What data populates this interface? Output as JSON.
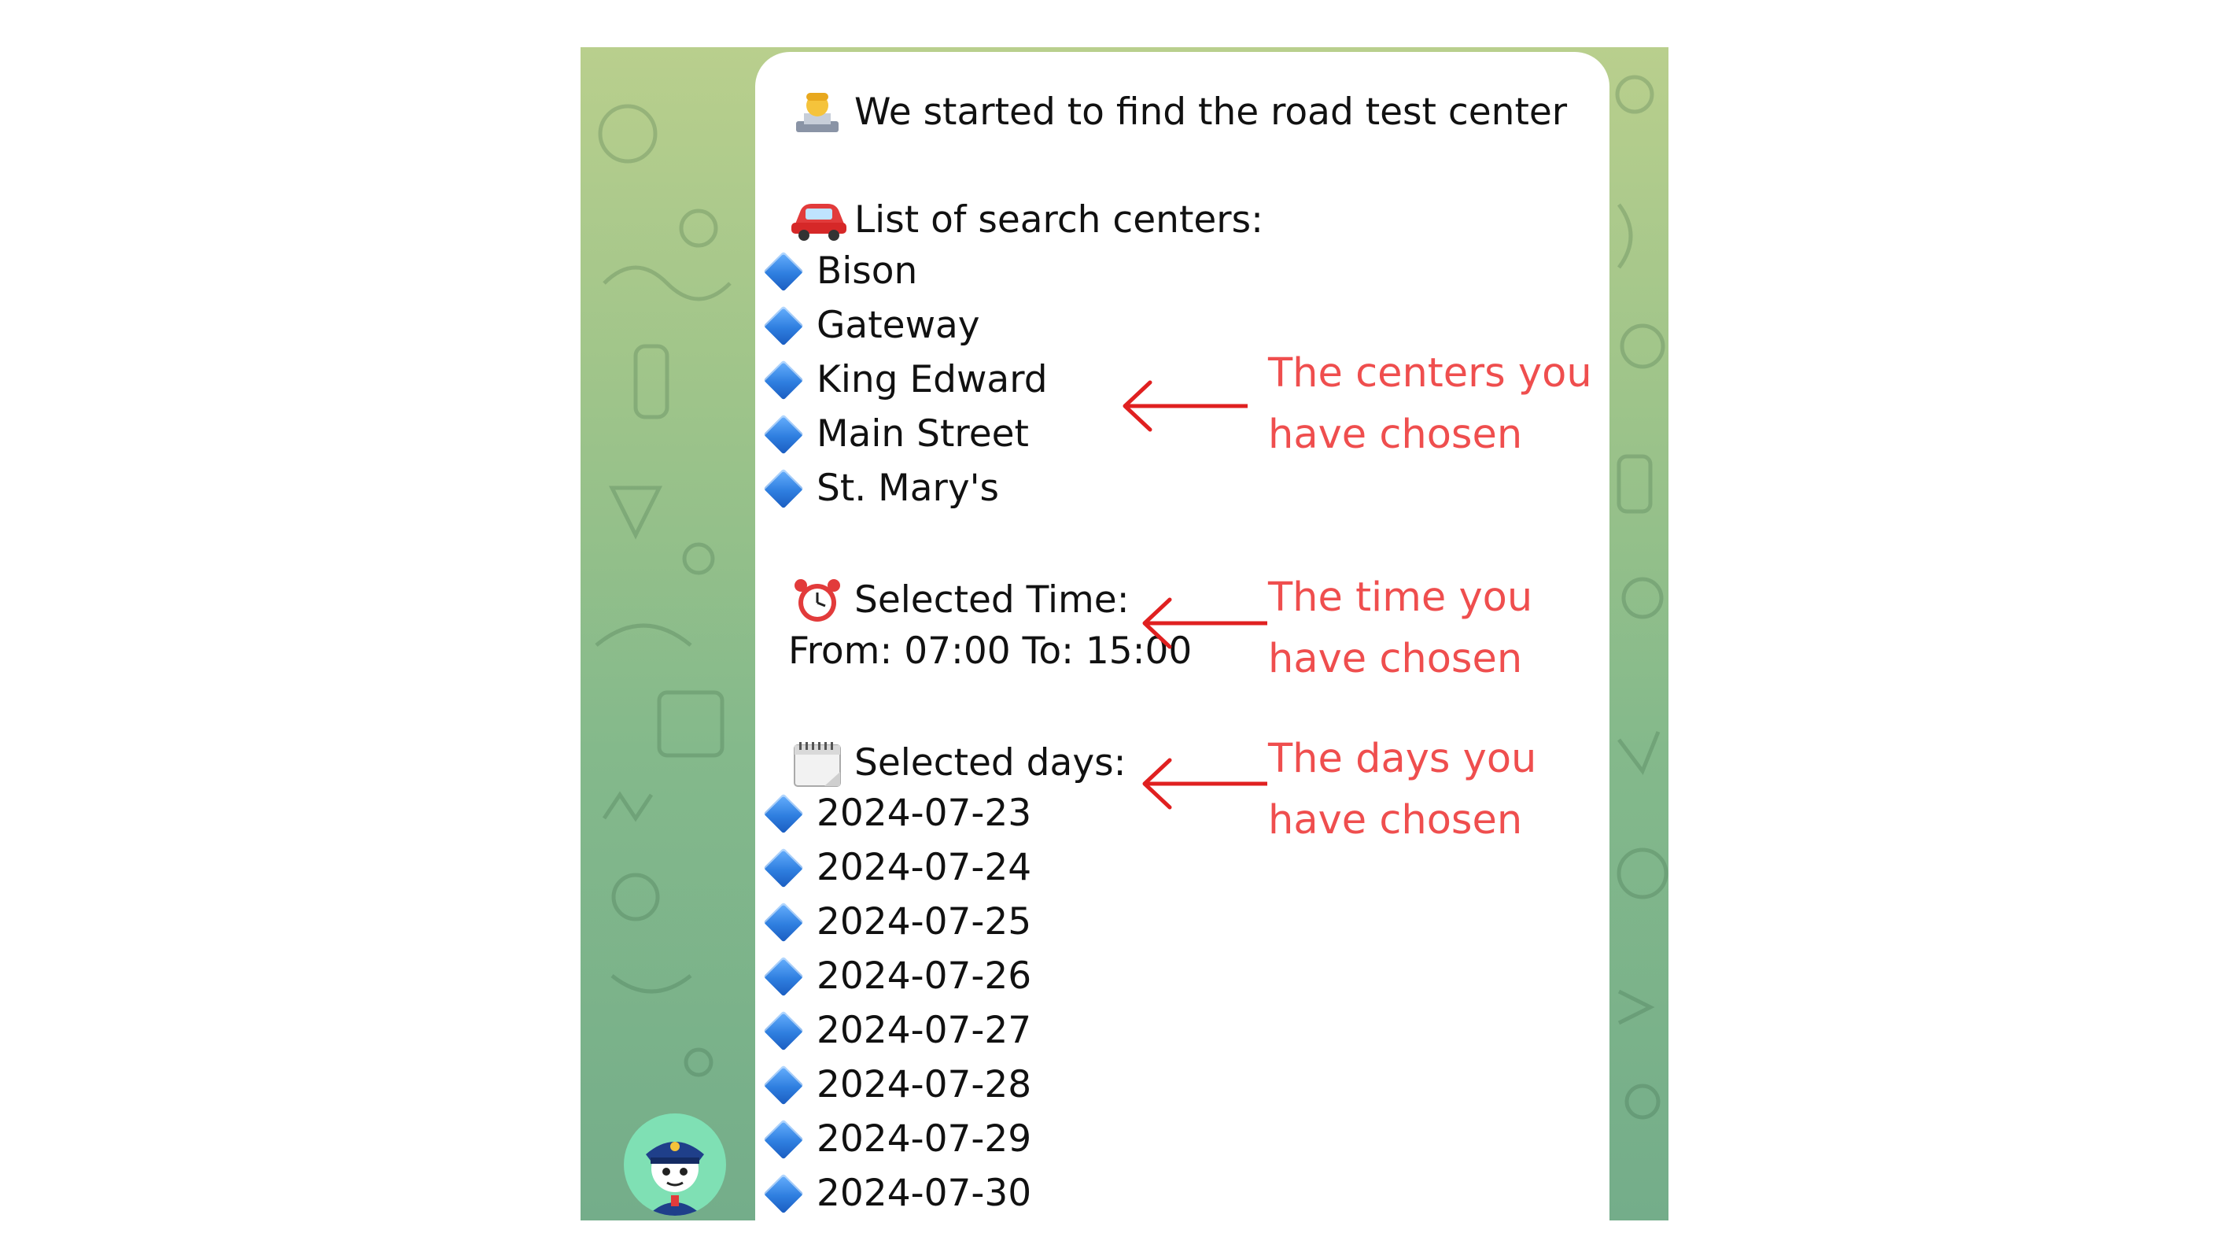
{
  "message": {
    "header": "We started to find the road test center",
    "centers_heading": "List of search centers:",
    "centers": [
      "Bison",
      "Gateway",
      "King Edward",
      "Main Street",
      "St. Mary's"
    ],
    "time_heading": "Selected Time:",
    "time_range": "From: 07:00 To: 15:00",
    "days_heading": "Selected days:",
    "days": [
      "2024-07-23",
      "2024-07-24",
      "2024-07-25",
      "2024-07-26",
      "2024-07-27",
      "2024-07-28",
      "2024-07-29",
      "2024-07-30"
    ]
  },
  "annotations": {
    "centers": [
      "The centers you",
      "have chosen"
    ],
    "time": [
      "The time you",
      "have chosen"
    ],
    "days": [
      "The days you",
      "have chosen"
    ]
  },
  "icons": {
    "header": "technologist-emoji",
    "centers": "red-car-emoji",
    "time": "alarm-clock-emoji",
    "days": "calendar-emoji",
    "bullet": "blue-diamond-emoji",
    "avatar": "police-officer-bot-avatar"
  },
  "colors": {
    "annotation": "#ef4e4e",
    "bullet": "#2f7fe0",
    "avatar_bg": "#7fe0b4"
  }
}
